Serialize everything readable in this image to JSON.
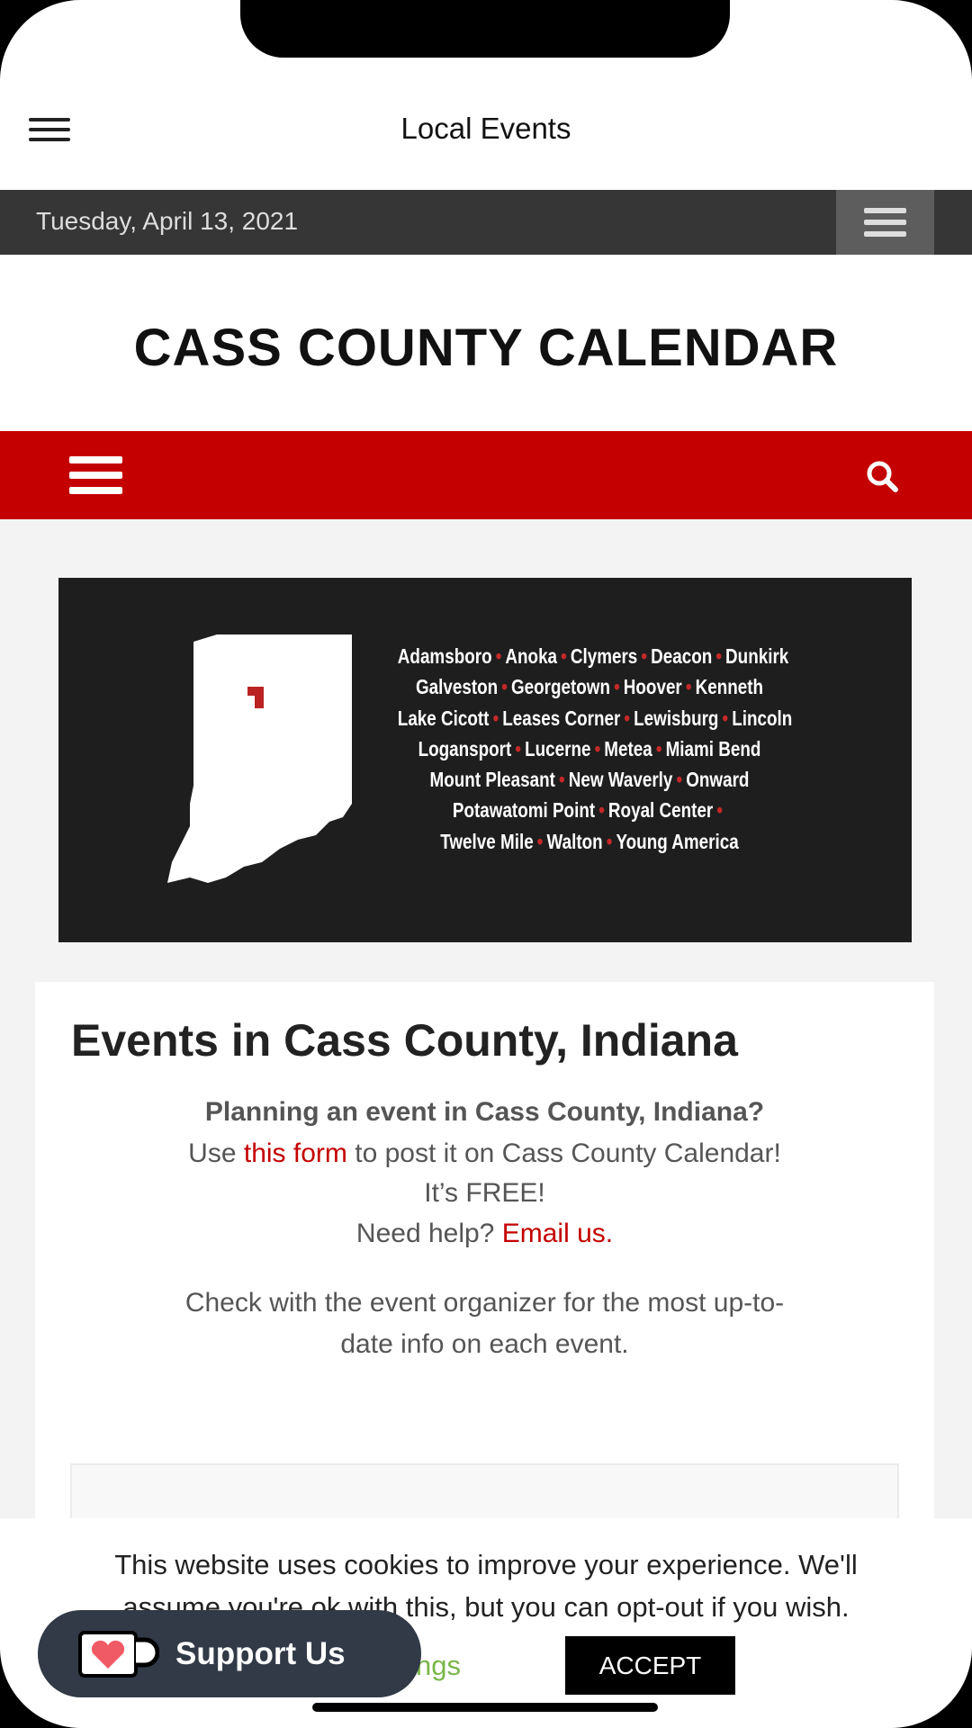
{
  "app_bar": {
    "title": "Local Events",
    "menu_icon": "hamburger-icon"
  },
  "top_bar": {
    "date": "Tuesday, April 13, 2021",
    "menu_icon": "hamburger-icon"
  },
  "site": {
    "logo_text": "CASS COUNTY CALENDAR"
  },
  "nav_bar": {
    "menu_icon": "hamburger-icon",
    "search_icon": "search-icon",
    "color": "#c40000"
  },
  "banner": {
    "towns": [
      [
        "Adamsboro",
        "Anoka",
        "Clymers",
        "Deacon",
        "Dunkirk"
      ],
      [
        "Galveston",
        "Georgetown",
        "Hoover",
        "Kenneth"
      ],
      [
        "Lake Cicott",
        "Leases Corner",
        "Lewisburg",
        "Lincoln"
      ],
      [
        "Logansport",
        "Lucerne",
        "Metea",
        "Miami Bend"
      ],
      [
        "Mount Pleasant",
        "New Waverly",
        "Onward"
      ],
      [
        "Potawatomi Point",
        "Royal Center",
        ""
      ],
      [
        "Twelve Mile",
        "Walton",
        "Young America"
      ]
    ]
  },
  "content": {
    "heading": "Events in Cass County, Indiana",
    "question": "Planning an event in Cass County, Indiana?",
    "use": "Use",
    "form_link": "this form",
    "post_text": "to post it on Cass County Calendar!",
    "free": "It’s FREE!",
    "help": "Need help?",
    "email_link": "Email us.",
    "note_line1": "Check with the event organizer for the most up-to-",
    "note_line2": "date info on each event."
  },
  "cookie": {
    "line1": "This website uses cookies to improve your experience. We'll",
    "line2": "assume you're ok with this, but you can opt-out if you wish.",
    "settings": "Settings",
    "accept": "ACCEPT"
  },
  "support": {
    "label": "Support Us",
    "icon": "heart-mug-icon"
  }
}
